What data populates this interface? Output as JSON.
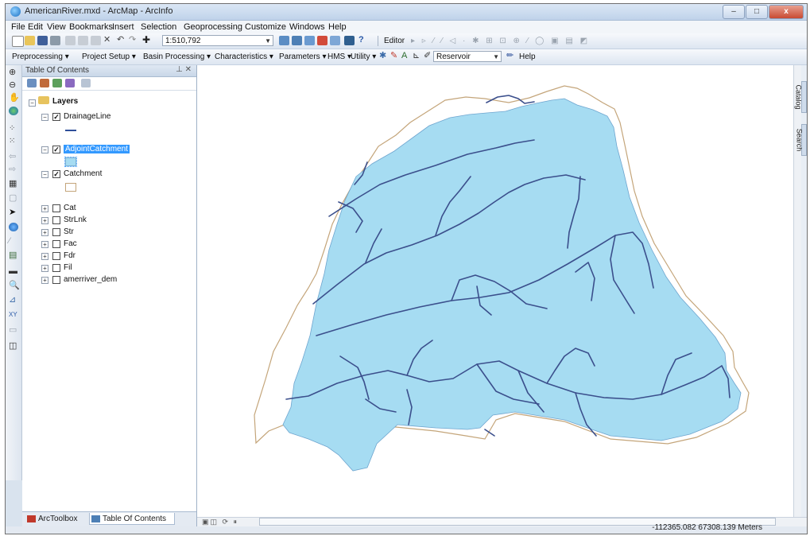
{
  "window": {
    "title": "AmericanRiver.mxd - ArcMap - ArcInfo"
  },
  "menu": [
    "File",
    "Edit",
    "View",
    "Bookmarks",
    "Insert",
    "Selection",
    "Geoprocessing",
    "Customize",
    "Windows",
    "Help"
  ],
  "toolbar1": {
    "scale": "1:510,792",
    "editor_label": "Editor"
  },
  "toolbar2": {
    "menus": [
      "Preprocessing",
      "Project Setup",
      "Basin Processing",
      "Characteristics",
      "Parameters",
      "HMS",
      "Utility"
    ],
    "layer_select": "Reservoir",
    "help_label": "Help"
  },
  "toc": {
    "title": "Table Of Contents",
    "root": "Layers",
    "layers": [
      {
        "name": "DrainageLine",
        "checked": true,
        "expanded": true
      },
      {
        "name": "AdjointCatchment",
        "checked": true,
        "expanded": true,
        "selected": true
      },
      {
        "name": "Catchment",
        "checked": true,
        "expanded": true
      },
      {
        "name": "Cat",
        "checked": false
      },
      {
        "name": "StrLnk",
        "checked": false
      },
      {
        "name": "Str",
        "checked": false
      },
      {
        "name": "Fac",
        "checked": false
      },
      {
        "name": "Fdr",
        "checked": false
      },
      {
        "name": "Fil",
        "checked": false
      },
      {
        "name": "amerriver_dem",
        "checked": false
      }
    ],
    "tabs": [
      "ArcToolbox",
      "Table Of Contents"
    ]
  },
  "side_tabs": [
    "Catalog",
    "Search"
  ],
  "status": {
    "coordinates": "-112365.082  67308.139 Meters"
  },
  "colors": {
    "catchment_fill": "#a6dcf2",
    "drainage_line": "#3b4f8c",
    "catchment_outline": "#c4a57a"
  }
}
